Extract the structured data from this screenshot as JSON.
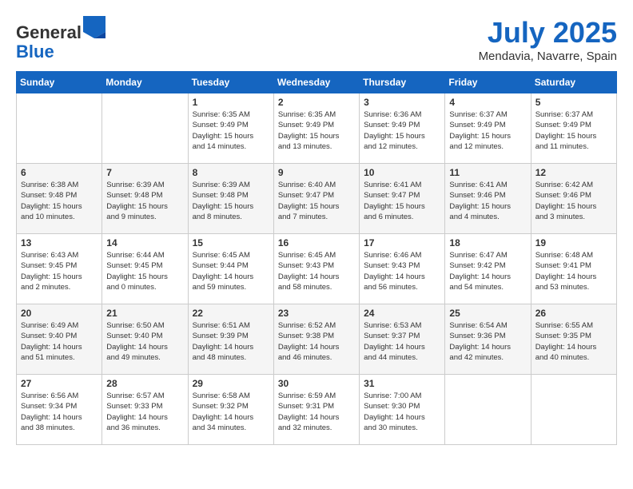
{
  "header": {
    "logo_general": "General",
    "logo_blue": "Blue",
    "month_title": "July 2025",
    "location": "Mendavia, Navarre, Spain"
  },
  "weekdays": [
    "Sunday",
    "Monday",
    "Tuesday",
    "Wednesday",
    "Thursday",
    "Friday",
    "Saturday"
  ],
  "weeks": [
    [
      {
        "day": "",
        "info": ""
      },
      {
        "day": "",
        "info": ""
      },
      {
        "day": "1",
        "info": "Sunrise: 6:35 AM\nSunset: 9:49 PM\nDaylight: 15 hours\nand 14 minutes."
      },
      {
        "day": "2",
        "info": "Sunrise: 6:35 AM\nSunset: 9:49 PM\nDaylight: 15 hours\nand 13 minutes."
      },
      {
        "day": "3",
        "info": "Sunrise: 6:36 AM\nSunset: 9:49 PM\nDaylight: 15 hours\nand 12 minutes."
      },
      {
        "day": "4",
        "info": "Sunrise: 6:37 AM\nSunset: 9:49 PM\nDaylight: 15 hours\nand 12 minutes."
      },
      {
        "day": "5",
        "info": "Sunrise: 6:37 AM\nSunset: 9:49 PM\nDaylight: 15 hours\nand 11 minutes."
      }
    ],
    [
      {
        "day": "6",
        "info": "Sunrise: 6:38 AM\nSunset: 9:48 PM\nDaylight: 15 hours\nand 10 minutes."
      },
      {
        "day": "7",
        "info": "Sunrise: 6:39 AM\nSunset: 9:48 PM\nDaylight: 15 hours\nand 9 minutes."
      },
      {
        "day": "8",
        "info": "Sunrise: 6:39 AM\nSunset: 9:48 PM\nDaylight: 15 hours\nand 8 minutes."
      },
      {
        "day": "9",
        "info": "Sunrise: 6:40 AM\nSunset: 9:47 PM\nDaylight: 15 hours\nand 7 minutes."
      },
      {
        "day": "10",
        "info": "Sunrise: 6:41 AM\nSunset: 9:47 PM\nDaylight: 15 hours\nand 6 minutes."
      },
      {
        "day": "11",
        "info": "Sunrise: 6:41 AM\nSunset: 9:46 PM\nDaylight: 15 hours\nand 4 minutes."
      },
      {
        "day": "12",
        "info": "Sunrise: 6:42 AM\nSunset: 9:46 PM\nDaylight: 15 hours\nand 3 minutes."
      }
    ],
    [
      {
        "day": "13",
        "info": "Sunrise: 6:43 AM\nSunset: 9:45 PM\nDaylight: 15 hours\nand 2 minutes."
      },
      {
        "day": "14",
        "info": "Sunrise: 6:44 AM\nSunset: 9:45 PM\nDaylight: 15 hours\nand 0 minutes."
      },
      {
        "day": "15",
        "info": "Sunrise: 6:45 AM\nSunset: 9:44 PM\nDaylight: 14 hours\nand 59 minutes."
      },
      {
        "day": "16",
        "info": "Sunrise: 6:45 AM\nSunset: 9:43 PM\nDaylight: 14 hours\nand 58 minutes."
      },
      {
        "day": "17",
        "info": "Sunrise: 6:46 AM\nSunset: 9:43 PM\nDaylight: 14 hours\nand 56 minutes."
      },
      {
        "day": "18",
        "info": "Sunrise: 6:47 AM\nSunset: 9:42 PM\nDaylight: 14 hours\nand 54 minutes."
      },
      {
        "day": "19",
        "info": "Sunrise: 6:48 AM\nSunset: 9:41 PM\nDaylight: 14 hours\nand 53 minutes."
      }
    ],
    [
      {
        "day": "20",
        "info": "Sunrise: 6:49 AM\nSunset: 9:40 PM\nDaylight: 14 hours\nand 51 minutes."
      },
      {
        "day": "21",
        "info": "Sunrise: 6:50 AM\nSunset: 9:40 PM\nDaylight: 14 hours\nand 49 minutes."
      },
      {
        "day": "22",
        "info": "Sunrise: 6:51 AM\nSunset: 9:39 PM\nDaylight: 14 hours\nand 48 minutes."
      },
      {
        "day": "23",
        "info": "Sunrise: 6:52 AM\nSunset: 9:38 PM\nDaylight: 14 hours\nand 46 minutes."
      },
      {
        "day": "24",
        "info": "Sunrise: 6:53 AM\nSunset: 9:37 PM\nDaylight: 14 hours\nand 44 minutes."
      },
      {
        "day": "25",
        "info": "Sunrise: 6:54 AM\nSunset: 9:36 PM\nDaylight: 14 hours\nand 42 minutes."
      },
      {
        "day": "26",
        "info": "Sunrise: 6:55 AM\nSunset: 9:35 PM\nDaylight: 14 hours\nand 40 minutes."
      }
    ],
    [
      {
        "day": "27",
        "info": "Sunrise: 6:56 AM\nSunset: 9:34 PM\nDaylight: 14 hours\nand 38 minutes."
      },
      {
        "day": "28",
        "info": "Sunrise: 6:57 AM\nSunset: 9:33 PM\nDaylight: 14 hours\nand 36 minutes."
      },
      {
        "day": "29",
        "info": "Sunrise: 6:58 AM\nSunset: 9:32 PM\nDaylight: 14 hours\nand 34 minutes."
      },
      {
        "day": "30",
        "info": "Sunrise: 6:59 AM\nSunset: 9:31 PM\nDaylight: 14 hours\nand 32 minutes."
      },
      {
        "day": "31",
        "info": "Sunrise: 7:00 AM\nSunset: 9:30 PM\nDaylight: 14 hours\nand 30 minutes."
      },
      {
        "day": "",
        "info": ""
      },
      {
        "day": "",
        "info": ""
      }
    ]
  ]
}
